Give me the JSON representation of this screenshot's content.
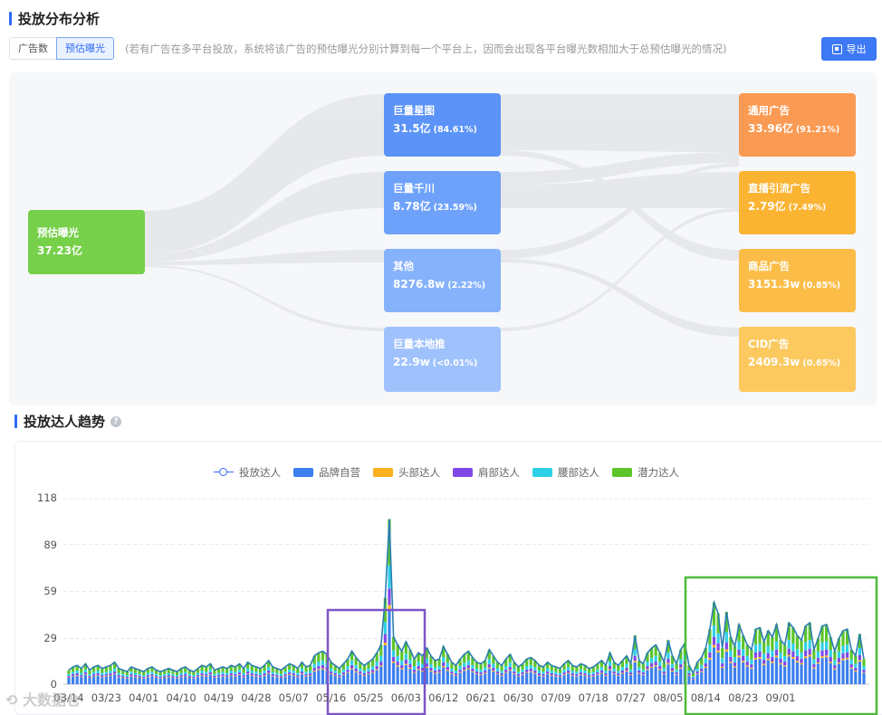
{
  "section1": {
    "title": "投放分布分析"
  },
  "tabs": [
    {
      "label": "广告数"
    },
    {
      "label": "预估曝光"
    }
  ],
  "note": "(若有广告在多平台投放，系统将该广告的预估曝光分别计算到每一个平台上，因而会出现各平台曝光数相加大于总预估曝光的情况)",
  "export": {
    "label": "导出",
    "icon": "excel-export-icon"
  },
  "sankey": {
    "source": {
      "name": "预估曝光",
      "value": "37.23亿",
      "color": "#76d04a"
    },
    "platforms": [
      {
        "name": "巨量星图",
        "value": "31.5亿",
        "pct": "(84.61%)",
        "color": "#5b93f8"
      },
      {
        "name": "巨量千川",
        "value": "8.78亿",
        "pct": "(23.59%)",
        "color": "#6ea2fa"
      },
      {
        "name": "其他",
        "value": "8276.8w",
        "pct": "(2.22%)",
        "color": "#86b2fb"
      },
      {
        "name": "巨量本地推",
        "value": "22.9w",
        "pct": "(<0.01%)",
        "color": "#9fc2fd"
      }
    ],
    "types": [
      {
        "name": "通用广告",
        "value": "33.96亿",
        "pct": "(91.21%)",
        "color": "#fb9a52"
      },
      {
        "name": "直播引流广告",
        "value": "2.79亿",
        "pct": "(7.49%)",
        "color": "#fbb332"
      },
      {
        "name": "商品广告",
        "value": "3151.3w",
        "pct": "(0.85%)",
        "color": "#fbbd48"
      },
      {
        "name": "CID广告",
        "value": "2409.3w",
        "pct": "(0.65%)",
        "color": "#fcc95f"
      }
    ]
  },
  "section2": {
    "title": "投放达人趋势",
    "help_icon": "question-circle-icon"
  },
  "chart_data": {
    "type": "bar",
    "title": "",
    "legend": [
      {
        "name": "投放达人",
        "kind": "line",
        "color": "#2f6cf6"
      },
      {
        "name": "品牌自营",
        "kind": "bar",
        "color": "#3c7ff0"
      },
      {
        "name": "头部达人",
        "kind": "bar",
        "color": "#fbb020"
      },
      {
        "name": "肩部达人",
        "kind": "bar",
        "color": "#8148e6"
      },
      {
        "name": "腰部达人",
        "kind": "bar",
        "color": "#2ed0e8"
      },
      {
        "name": "潜力达人",
        "kind": "bar",
        "color": "#5cc52a"
      }
    ],
    "yticks": [
      "118",
      "89",
      "59",
      "29",
      "0"
    ],
    "ylim": [
      0,
      118
    ],
    "xticks": [
      "03/14",
      "03/23",
      "04/01",
      "04/10",
      "04/19",
      "04/28",
      "05/07",
      "05/16",
      "05/25",
      "06/03",
      "06/12",
      "06/21",
      "06/30",
      "07/09",
      "07/18",
      "07/27",
      "08/05",
      "08/14",
      "08/23",
      "09/01"
    ],
    "start_date": "03/14",
    "totals": [
      9,
      11,
      12,
      10,
      13,
      9,
      11,
      12,
      10,
      11,
      12,
      14,
      10,
      9,
      8,
      11,
      10,
      9,
      8,
      10,
      11,
      9,
      8,
      9,
      10,
      9,
      8,
      10,
      11,
      9,
      8,
      10,
      12,
      11,
      13,
      9,
      10,
      11,
      10,
      12,
      11,
      13,
      10,
      14,
      12,
      11,
      10,
      12,
      15,
      11,
      10,
      9,
      11,
      13,
      12,
      10,
      14,
      11,
      12,
      18,
      20,
      21,
      19,
      14,
      12,
      10,
      13,
      16,
      21,
      17,
      14,
      12,
      14,
      16,
      20,
      25,
      55,
      105,
      30,
      25,
      21,
      27,
      22,
      16,
      20,
      18,
      23,
      18,
      15,
      16,
      24,
      19,
      14,
      12,
      16,
      19,
      21,
      17,
      14,
      13,
      15,
      22,
      18,
      14,
      12,
      16,
      19,
      14,
      11,
      13,
      16,
      17,
      15,
      12,
      11,
      14,
      12,
      11,
      10,
      13,
      15,
      12,
      11,
      13,
      12,
      10,
      11,
      13,
      15,
      12,
      20,
      14,
      12,
      15,
      18,
      13,
      31,
      15,
      13,
      20,
      23,
      25,
      20,
      14,
      28,
      18,
      13,
      22,
      26,
      12,
      7,
      14,
      17,
      23,
      35,
      52,
      45,
      23,
      46,
      30,
      24,
      38,
      31,
      25,
      22,
      35,
      36,
      27,
      34,
      30,
      38,
      28,
      25,
      39,
      36,
      31,
      28,
      37,
      39,
      22,
      29,
      37,
      38,
      30,
      21,
      29,
      34,
      35,
      22,
      18,
      32,
      16
    ]
  },
  "watermark": "大数据仓"
}
